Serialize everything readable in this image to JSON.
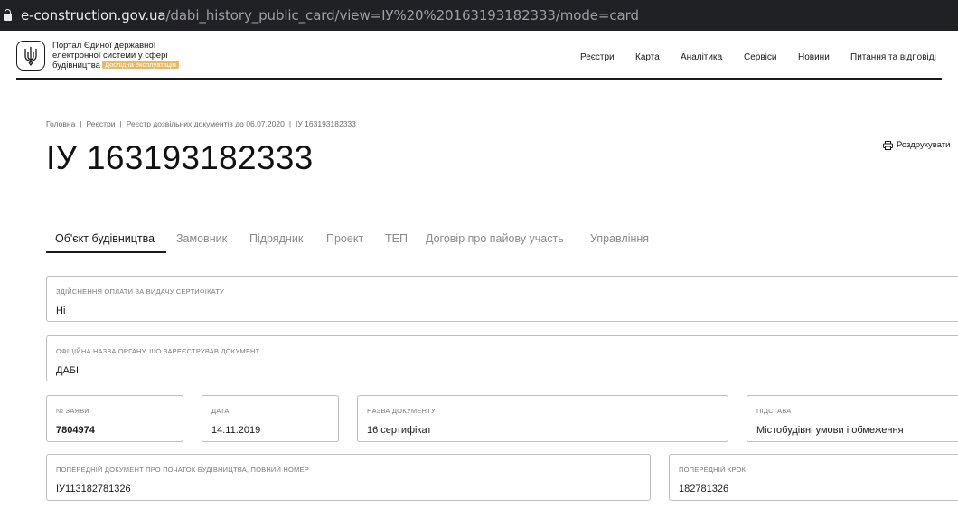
{
  "browser": {
    "url_host": "e-construction.gov.ua",
    "url_path": "/dabi_history_public_card/view=ІУ%20%20163193182333/mode=card"
  },
  "header": {
    "brand_line1": "Портал Єдиної державної",
    "brand_line2": "електронної системи у сфері",
    "brand_line3": "будівництва",
    "brand_badge": "Дослідна експлуатація",
    "nav": [
      "Реєстри",
      "Карта",
      "Аналітика",
      "Сервіси",
      "Новини",
      "Питання та відповіді"
    ]
  },
  "breadcrumbs": [
    "Головна",
    "Реєстри",
    "Реєстр дозвільних документів до 06.07.2020",
    "ІУ 163193182333"
  ],
  "page_title": "ІУ 163193182333",
  "print_label": "Роздрукувати",
  "tabs": [
    "Об'єкт будівництва",
    "Замовник",
    "Підрядник",
    "Проект",
    "ТЕП",
    "Договір про пайову участь",
    "Управління"
  ],
  "fields": {
    "payment": {
      "label": "Здійснення оплати за видачу сертифікату",
      "value": "Ні"
    },
    "authority": {
      "label": "Офіційна назва органу, що зареєстрував документ",
      "value": "ДАБІ"
    },
    "application_no": {
      "label": "№ заяви",
      "value": "7804974"
    },
    "date": {
      "label": "Дата",
      "value": "14.11.2019"
    },
    "doc_name": {
      "label": "Назва документу",
      "value": "16 сертифікат"
    },
    "basis": {
      "label": "Підстава",
      "value": "Містобудівні умови і обмеження"
    },
    "prev_doc": {
      "label": "Попередній документ про початок будівництва, повний номер",
      "value": "ІУ113182781326"
    },
    "prev_step": {
      "label": "Попередній крок",
      "value": "182781326"
    }
  },
  "colors": {
    "badge": "#e8b866",
    "browser_bar": "#202124",
    "border": "#bdbdbd"
  }
}
